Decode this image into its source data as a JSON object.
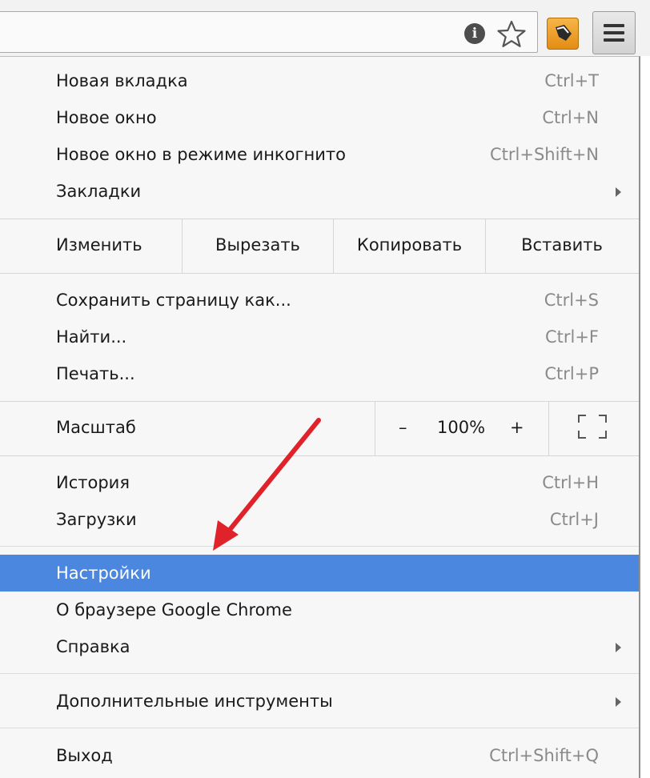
{
  "toolbar": {
    "icons": [
      "info-icon",
      "star-icon",
      "extension-icon",
      "menu-icon"
    ],
    "info_glyph": "i"
  },
  "menu": {
    "group1": [
      {
        "label": "Новая вкладка",
        "shortcut": "Ctrl+T"
      },
      {
        "label": "Новое окно",
        "shortcut": "Ctrl+N"
      },
      {
        "label": "Новое окно в режиме инкогнито",
        "shortcut": "Ctrl+Shift+N"
      },
      {
        "label": "Закладки",
        "shortcut": ""
      }
    ],
    "edit": {
      "label": "Изменить",
      "cut": "Вырезать",
      "copy": "Копировать",
      "paste": "Вставить"
    },
    "group2": [
      {
        "label": "Сохранить страницу как...",
        "shortcut": "Ctrl+S"
      },
      {
        "label": "Найти...",
        "shortcut": "Ctrl+F"
      },
      {
        "label": "Печать...",
        "shortcut": "Ctrl+P"
      }
    ],
    "zoom": {
      "label": "Масштаб",
      "minus": "–",
      "value": "100%",
      "plus": "+"
    },
    "group3": [
      {
        "label": "История",
        "shortcut": "Ctrl+H"
      },
      {
        "label": "Загрузки",
        "shortcut": "Ctrl+J"
      }
    ],
    "group4": [
      {
        "label": "Настройки",
        "highlighted": true
      },
      {
        "label": "О браузере Google Chrome"
      },
      {
        "label": "Справка"
      }
    ],
    "more_tools": {
      "label": "Дополнительные инструменты"
    },
    "exit": {
      "label": "Выход",
      "shortcut": "Ctrl+Shift+Q"
    }
  },
  "colors": {
    "highlight": "#4b87de",
    "annotation_arrow": "#e0232b"
  }
}
